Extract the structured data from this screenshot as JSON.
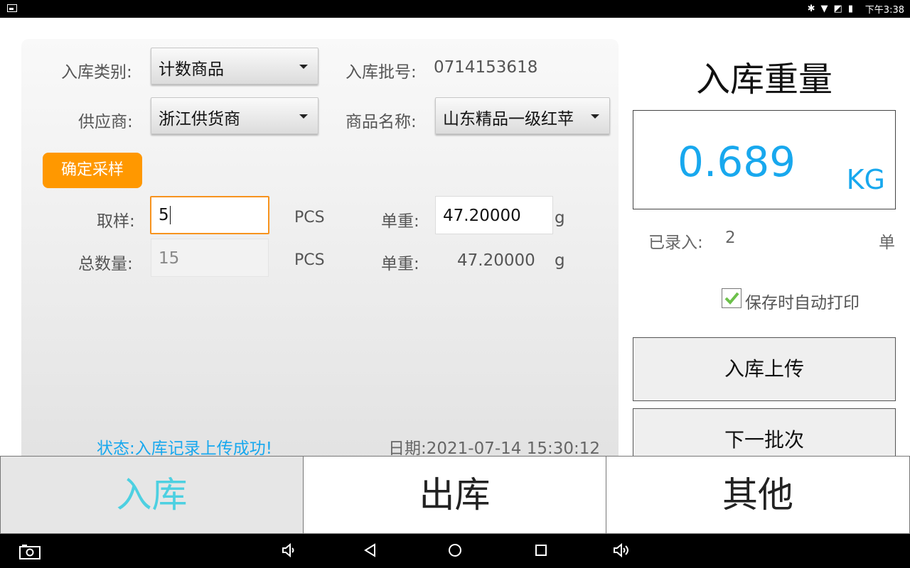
{
  "status_bar": {
    "time": "下午3:38"
  },
  "form": {
    "category_label": "入库类别:",
    "category_value": "计数商品",
    "batch_label": "入库批号:",
    "batch_value": "0714153618",
    "supplier_label": "供应商:",
    "supplier_value": "浙江供货商",
    "product_label": "商品名称:",
    "product_value": "山东精品一级红苹",
    "confirm_sample_label": "确定采样",
    "sample_label": "取样:",
    "sample_value": "5",
    "sample_unit": "PCS",
    "unit_weight_label": "单重:",
    "unit_weight_value": "47.20000",
    "unit_weight_unit": "g",
    "total_label": "总数量:",
    "total_value": "15",
    "total_unit": "PCS",
    "unit_weight2_label": "单重:",
    "unit_weight2_value": "47.20000",
    "unit_weight2_unit": "g",
    "status_text": "状态:入库记录上传成功!",
    "date_text": "日期:2021-07-14 15:30:12"
  },
  "weight": {
    "title": "入库重量",
    "value": "0.689",
    "unit": "KG",
    "recorded_label": "已录入:",
    "recorded_count": "2",
    "recorded_unit": "单",
    "auto_print_label": "保存时自动打印",
    "auto_print_checked": true,
    "upload_button": "入库上传",
    "next_batch_button": "下一批次"
  },
  "tabs": [
    {
      "label": "入库",
      "active": true
    },
    {
      "label": "出库",
      "active": false
    },
    {
      "label": "其他",
      "active": false
    }
  ],
  "colors": {
    "accent": "#18a8ee",
    "orange": "#ff9800",
    "active_tab_text": "#4dd0e1",
    "active_tab_bg": "#e6e6e6"
  }
}
